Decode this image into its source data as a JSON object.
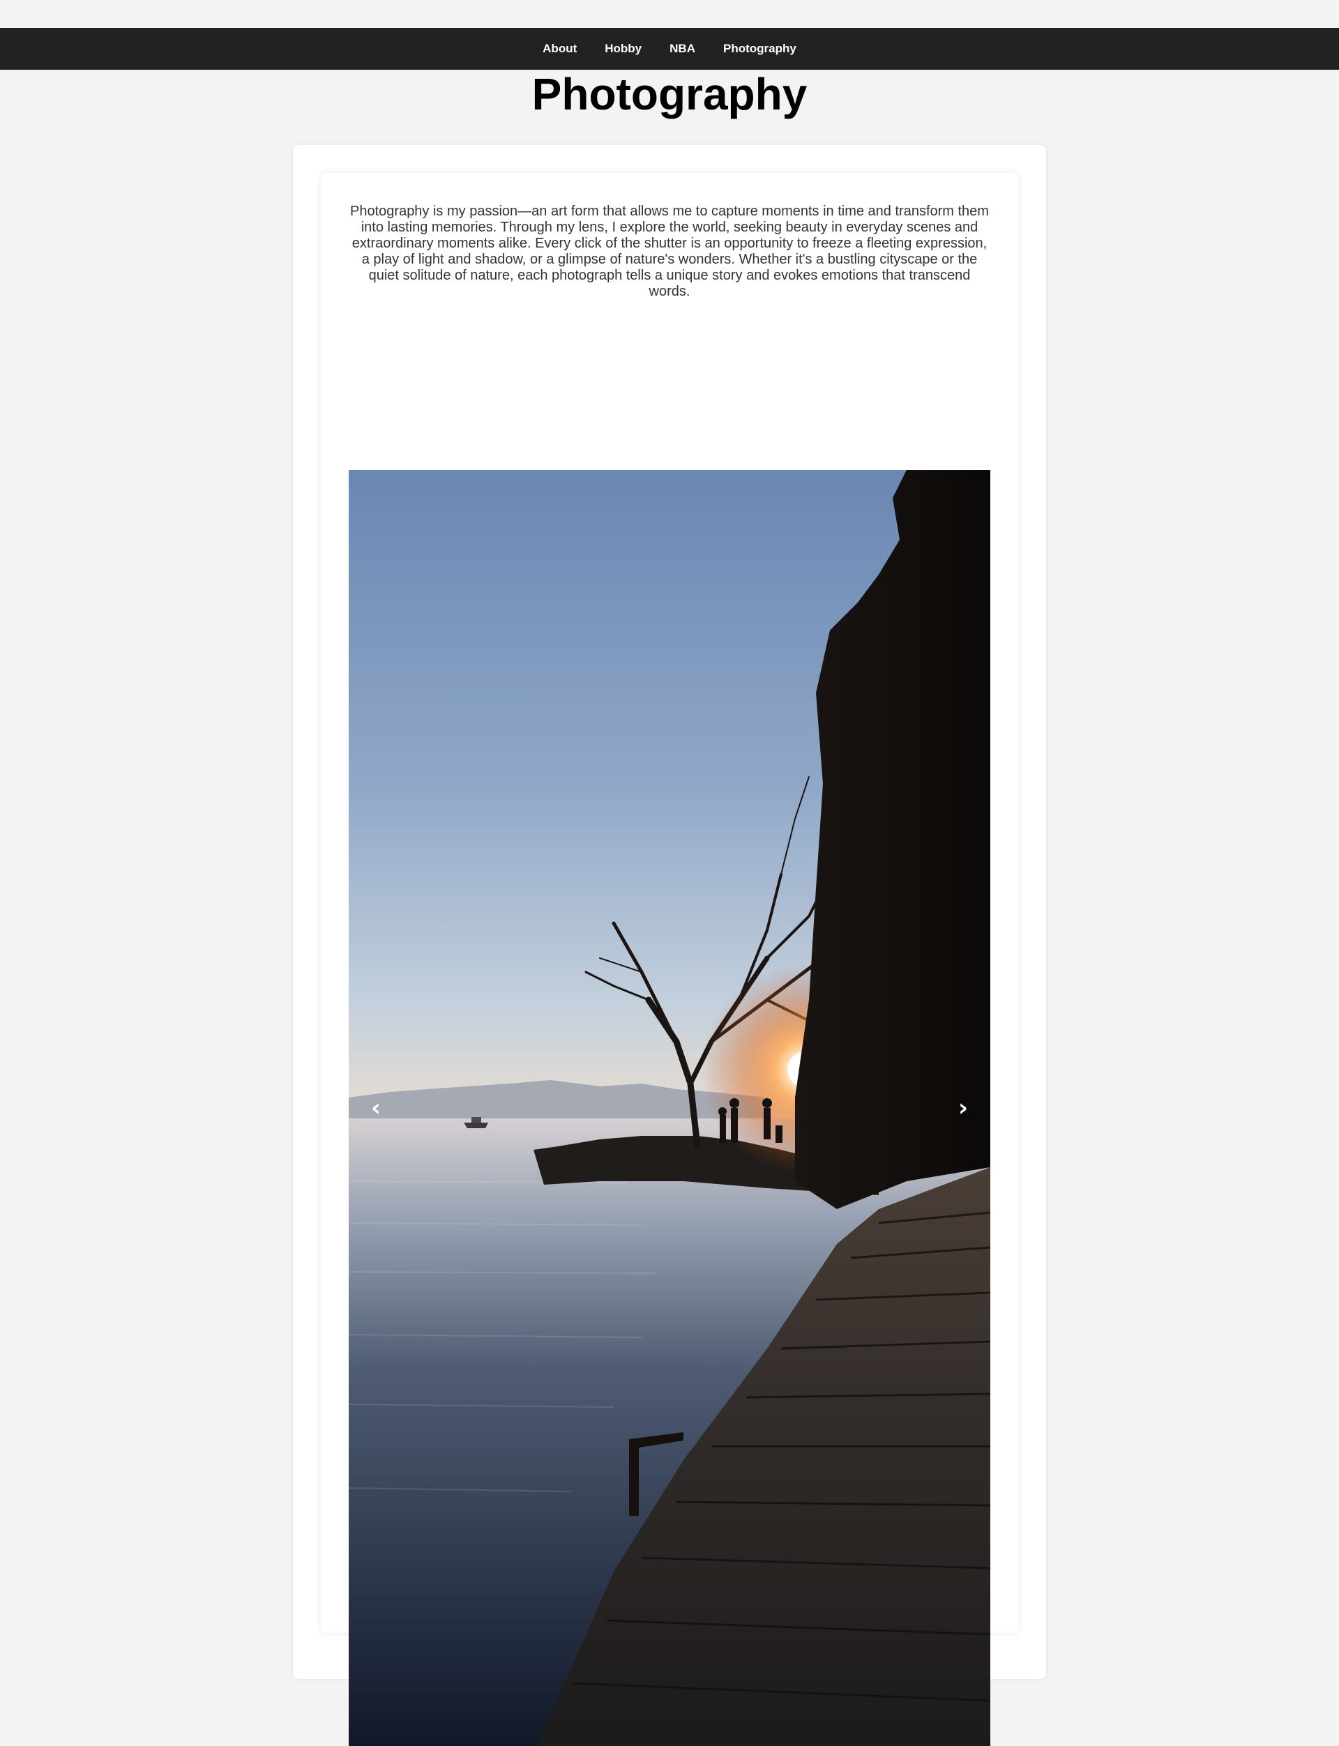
{
  "nav": {
    "items": [
      {
        "label": "About"
      },
      {
        "label": "Hobby"
      },
      {
        "label": "NBA"
      },
      {
        "label": "Photography"
      }
    ]
  },
  "page": {
    "title": "Photography",
    "intro": "Photography is my passion—an art form that allows me to capture moments in time and transform them into lasting memories. Through my lens, I explore the world, seeking beauty in everyday scenes and extraordinary moments alike. Every click of the shutter is an opportunity to freeze a fleeting expression, a play of light and shadow, or a glimpse of nature's wonders. Whether it's a bustling cityscape or the quiet solitude of nature, each photograph tells a unique story and evokes emotions that transcend words."
  },
  "carousel": {
    "prev_icon": "‹",
    "next_icon": "›",
    "icons": [
      "chevron-left-icon",
      "chevron-right-icon"
    ]
  },
  "colors": {
    "navbar_bg": "#222222",
    "page_bg": "#f3f3f3",
    "card_bg": "#ffffff",
    "text": "#333333"
  }
}
